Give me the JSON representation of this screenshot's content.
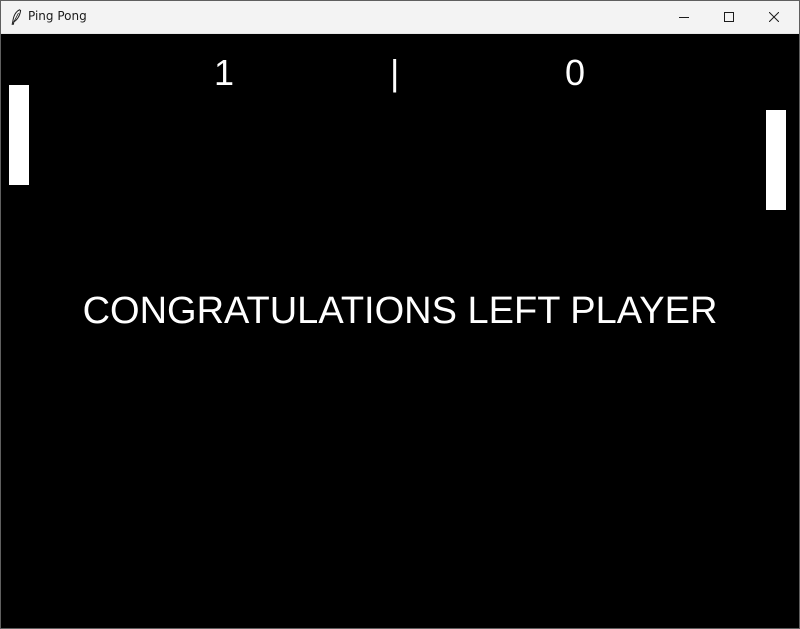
{
  "window": {
    "title": "Ping Pong",
    "controls": {
      "minimize_icon": "minimize-icon",
      "maximize_icon": "maximize-icon",
      "close_icon": "close-icon"
    }
  },
  "game": {
    "background_color": "#000000",
    "foreground_color": "#ffffff",
    "score": {
      "left": "1",
      "separator": "|",
      "right": "0"
    },
    "message": "CONGRATULATIONS LEFT PLAYER"
  }
}
